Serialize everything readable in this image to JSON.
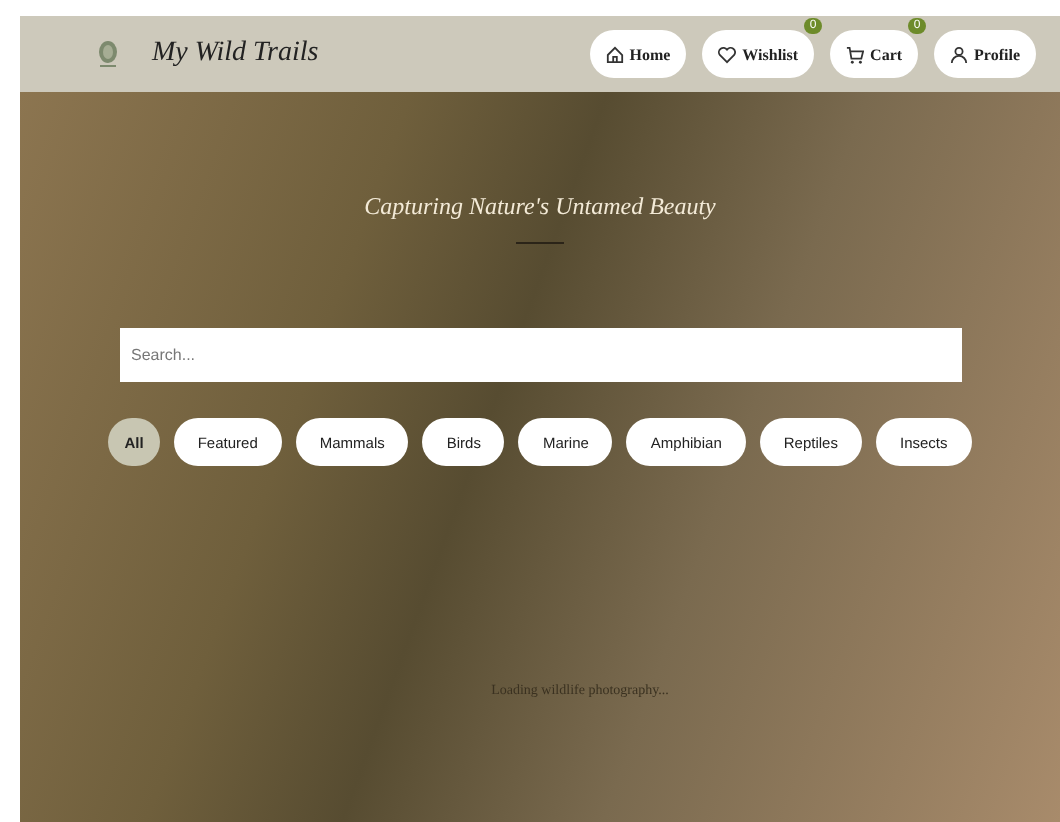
{
  "header": {
    "brand": "My Wild Trails",
    "nav": [
      {
        "kind": "home",
        "label": "Home"
      },
      {
        "kind": "heart",
        "label": "Wishlist",
        "badge": "0"
      },
      {
        "kind": "cart",
        "label": "Cart",
        "badge": "0"
      },
      {
        "kind": "person",
        "label": "Profile"
      }
    ]
  },
  "hero": {
    "tagline": "Capturing Nature's Untamed Beauty"
  },
  "search": {
    "placeholder": "Search..."
  },
  "filters": [
    {
      "label": "All",
      "selected": true
    },
    {
      "label": "Featured",
      "selected": false
    },
    {
      "label": "Mammals",
      "selected": false
    },
    {
      "label": "Birds",
      "selected": false
    },
    {
      "label": "Marine",
      "selected": false
    },
    {
      "label": "Amphibian",
      "selected": false
    },
    {
      "label": "Reptiles",
      "selected": false
    },
    {
      "label": "Insects",
      "selected": false
    }
  ],
  "loading": "Loading wildlife photography..."
}
